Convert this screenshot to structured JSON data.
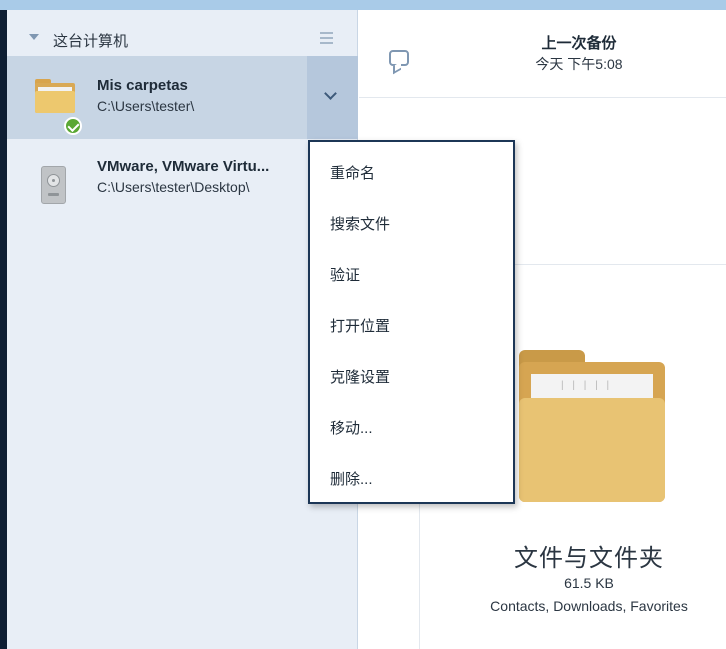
{
  "sidebar": {
    "section_title": "这台计算机",
    "items": [
      {
        "name": "Mis carpetas",
        "path": "C:\\Users\\tester\\"
      },
      {
        "name": "VMware, VMware Virtu...",
        "path": "C:\\Users\\tester\\Desktop\\"
      }
    ]
  },
  "header": {
    "last_backup_title": "上一次备份",
    "last_backup_time": "今天 下午5:08"
  },
  "context_menu": {
    "items": [
      "重命名",
      "搜索文件",
      "验证",
      "打开位置",
      "克隆设置",
      "移动...",
      "删除..."
    ]
  },
  "content": {
    "title": "文件与文件夹",
    "size": "61.5 KB",
    "folders": "Contacts, Downloads, Favorites"
  },
  "colors": {
    "selected_row": "#c7d5e4",
    "sidebar_bg": "#e8eef6",
    "menu_border": "#1c3656",
    "check_green": "#5aa834",
    "folder_yellow": "#e8c373"
  }
}
